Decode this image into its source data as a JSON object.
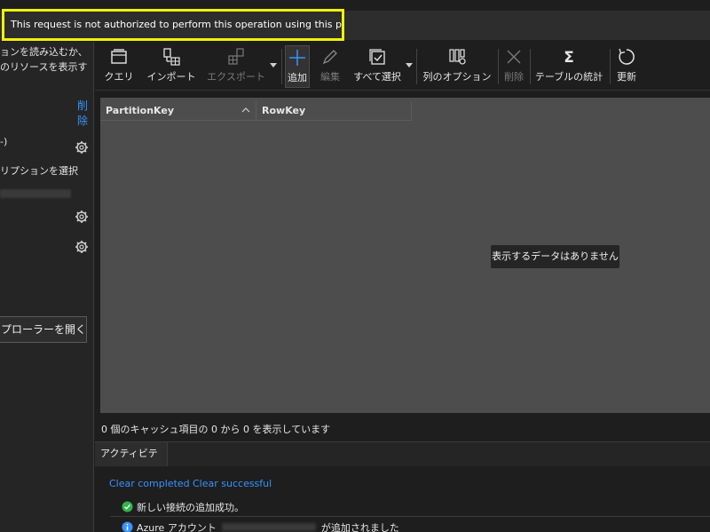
{
  "error_banner": {
    "message": "This request is not authorized to perform this operation using this permission."
  },
  "left_panel": {
    "text_line1": "ョンを読み込むか、",
    "text_line2": "のリソースを表示す",
    "remove_link_line1": "削",
    "remove_link_line2": "除",
    "item_label": "-)",
    "subscription_text": "リプションを選択",
    "open_explorer_label": "プローラーを開く"
  },
  "toolbar": {
    "query": "クエリ",
    "import": "インポート",
    "export": "エクスポート",
    "add": "追加",
    "edit": "編集",
    "select_all": "すべて選択",
    "column_options": "列のオプション",
    "delete": "削除",
    "table_stats": "テーブルの統計",
    "refresh": "更新"
  },
  "table": {
    "columns": [
      "PartitionKey",
      "RowKey"
    ],
    "empty_message": "表示するデータはありません",
    "cache_status": "0 個のキャッシュ項目の 0 から 0 を表示しています"
  },
  "activity": {
    "tab_label": "アクティビティ",
    "clear_completed": "Clear completed",
    "clear_successful": "Clear successful",
    "entries": [
      {
        "icon": "check-circle-icon",
        "text": "新しい接続の追加成功。"
      },
      {
        "icon": "info-circle-icon",
        "prefix": "Azure アカウント",
        "suffix": "が追加されました"
      }
    ]
  },
  "colors": {
    "accent_link": "#3794ff",
    "highlight_border": "#f2f20a",
    "success": "#2fb34a",
    "info": "#3794ff"
  }
}
